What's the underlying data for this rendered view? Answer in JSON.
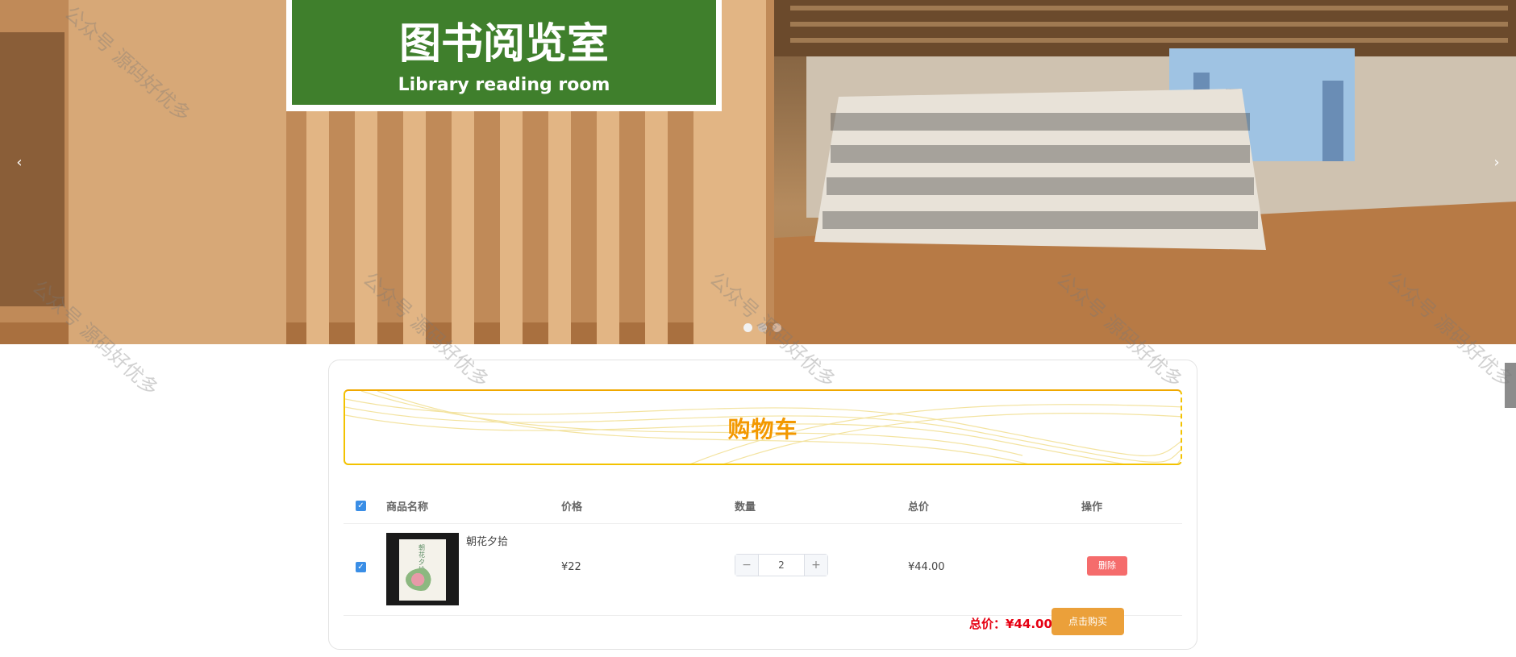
{
  "banner": {
    "sign_cn": "图书阅览室",
    "sign_en": "Library reading room",
    "prev_icon": "chevron-left-icon",
    "next_icon": "chevron-right-icon",
    "prev_glyph": "‹",
    "next_glyph": "›",
    "dots_count": 3,
    "active_dot": 1
  },
  "cart": {
    "title": "购物车",
    "columns": {
      "name": "商品名称",
      "price": "价格",
      "quantity": "数量",
      "total": "总价",
      "action": "操作"
    },
    "items": [
      {
        "name": "朝花夕拾",
        "cover_text": "朝花夕拾",
        "price": "¥22",
        "quantity": "2",
        "total": "¥44.00",
        "delete_label": "删除",
        "checked": true
      }
    ],
    "minus_glyph": "−",
    "plus_glyph": "+",
    "check_glyph": "✓",
    "total_label": "总价：",
    "total_value": "¥44.00",
    "buy_label": "点击购买"
  },
  "watermark": "公众号 源码好优多",
  "colors": {
    "accent": "#f39800",
    "checkbox": "#3a8ee6",
    "delete": "#f56c6c",
    "buy": "#eba03a",
    "price_red": "#e60012"
  }
}
